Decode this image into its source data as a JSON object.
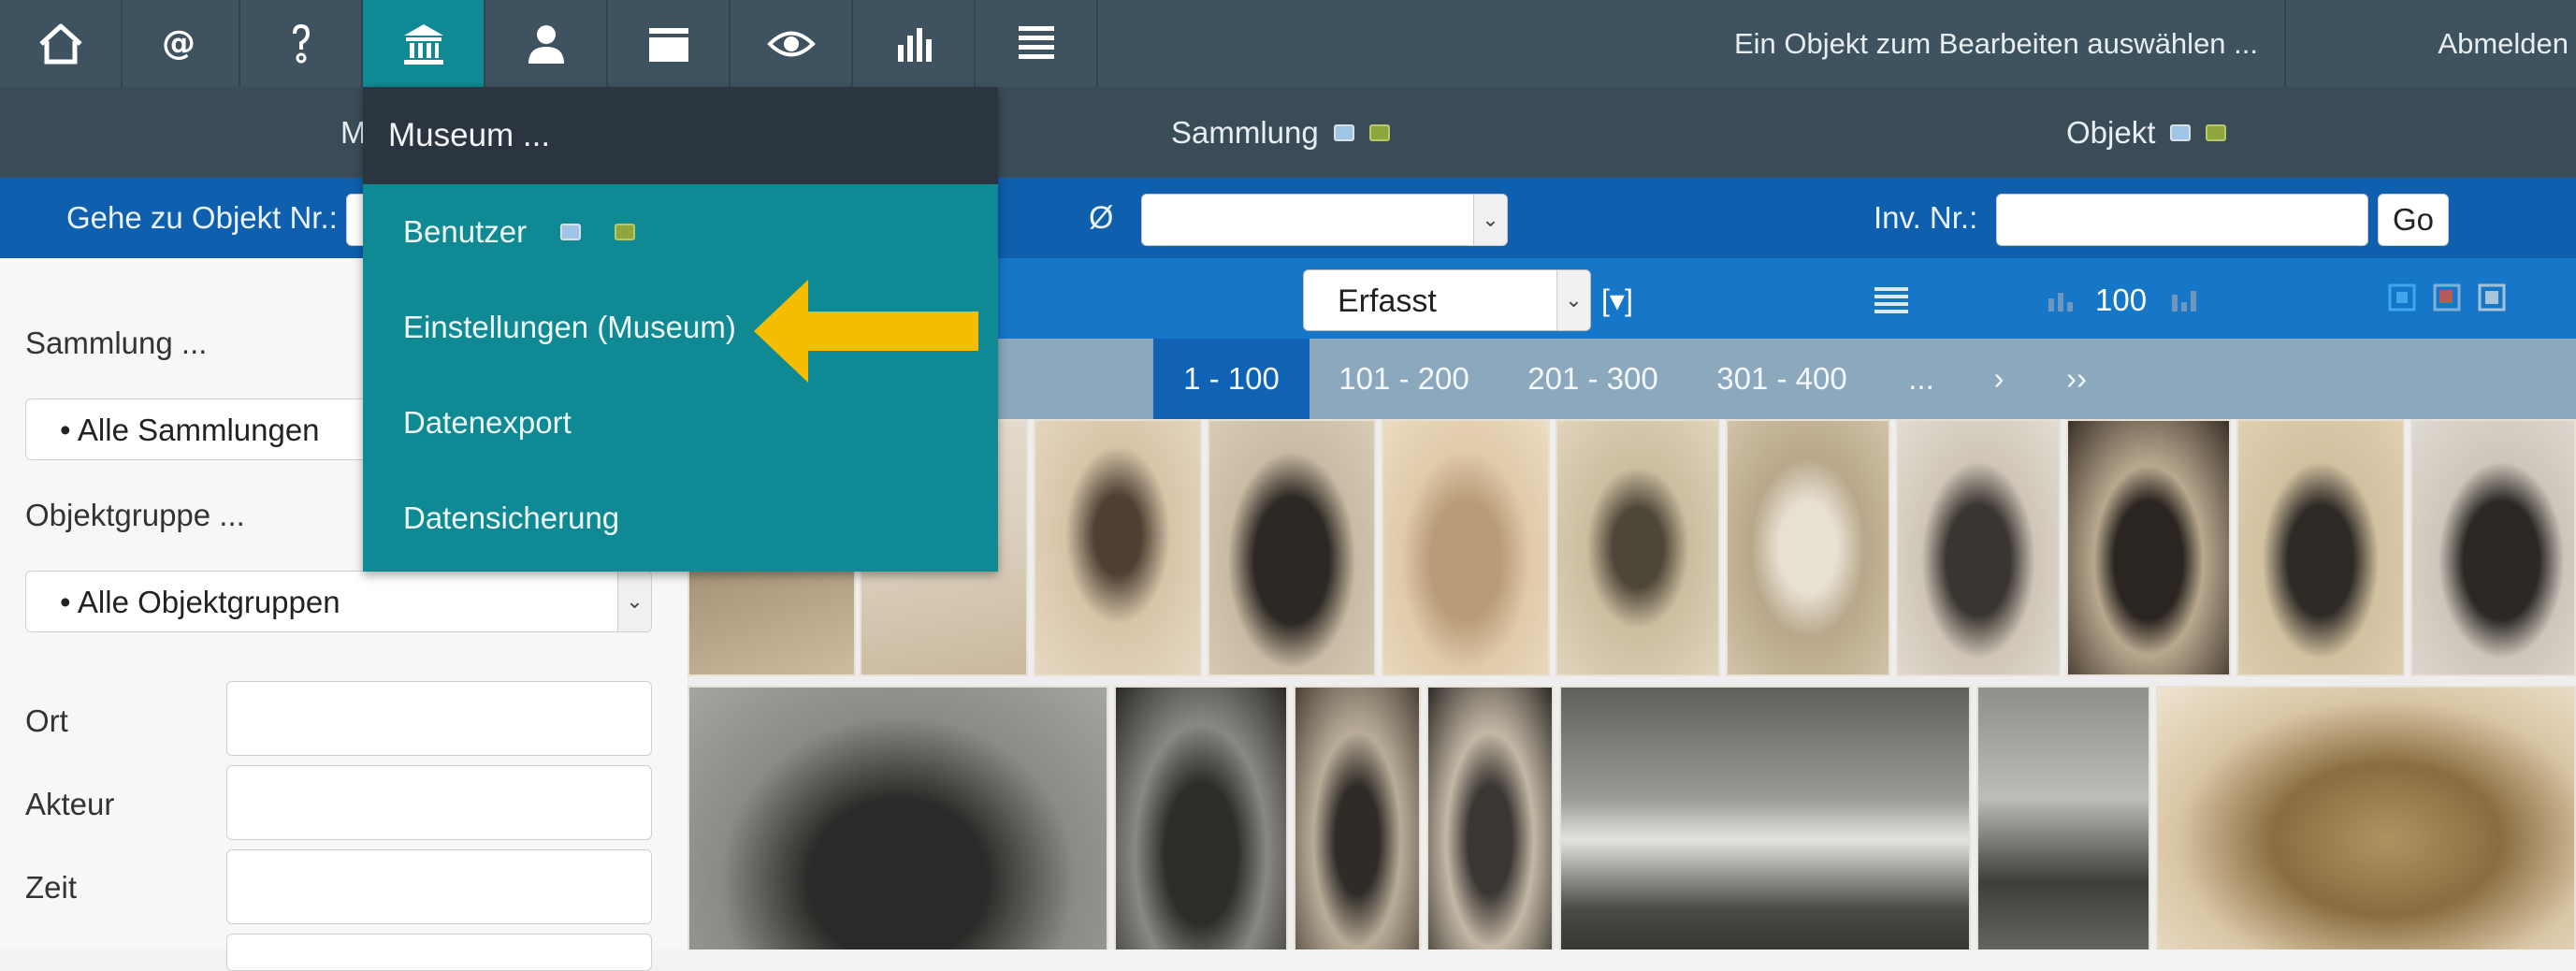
{
  "topbar": {
    "icons": [
      "home-icon",
      "at-sign-icon",
      "question-icon",
      "museum-icon",
      "user-icon",
      "clapperboard-icon",
      "eye-icon",
      "bar-chart-icon",
      "list-icon"
    ],
    "active_icon": "museum-icon",
    "status_text": "Ein Objekt zum Bearbeiten auswählen ...",
    "logout_label": "Abmelden"
  },
  "bar2": {
    "museum_label_partial": "M",
    "sammlung_label": "Sammlung",
    "objekt_label": "Objekt"
  },
  "search": {
    "goto_label": "Gehe zu Objekt Nr.:",
    "diameter_symbol": "Ø",
    "inv_label": "Inv. Nr.:",
    "inv_value": "",
    "go_label": "Go"
  },
  "toolbar": {
    "status_value": "Erfasst",
    "filter_icon": "[▾]",
    "page_size": "100"
  },
  "pagination": {
    "pages": [
      "1 - 100",
      "101 - 200",
      "201 - 300",
      "301 - 400",
      "...",
      "›",
      "››"
    ],
    "active_page": "1 - 100"
  },
  "sidebar": {
    "sammlung_label": "Sammlung ...",
    "sammlung_value": "• Alle Sammlungen",
    "objektgruppe_label": "Objektgruppe ...",
    "objektgruppe_value": "• Alle Objektgruppen",
    "fields": [
      {
        "label": "Ort",
        "value": ""
      },
      {
        "label": "Akteur",
        "value": ""
      },
      {
        "label": "Zeit",
        "value": ""
      }
    ]
  },
  "dropdown_menu": {
    "header": "Museum ...",
    "items": [
      "Benutzer",
      "Einstellungen (Museum)",
      "Datenexport",
      "Datensicherung"
    ],
    "highlighted_item": "Einstellungen (Museum)"
  },
  "colors": {
    "topbar": "#3f5260",
    "active_nav": "#0f8a94",
    "search_bar": "#0e5fae",
    "toolbar": "#1677c8",
    "arrow": "#f5bd00"
  }
}
